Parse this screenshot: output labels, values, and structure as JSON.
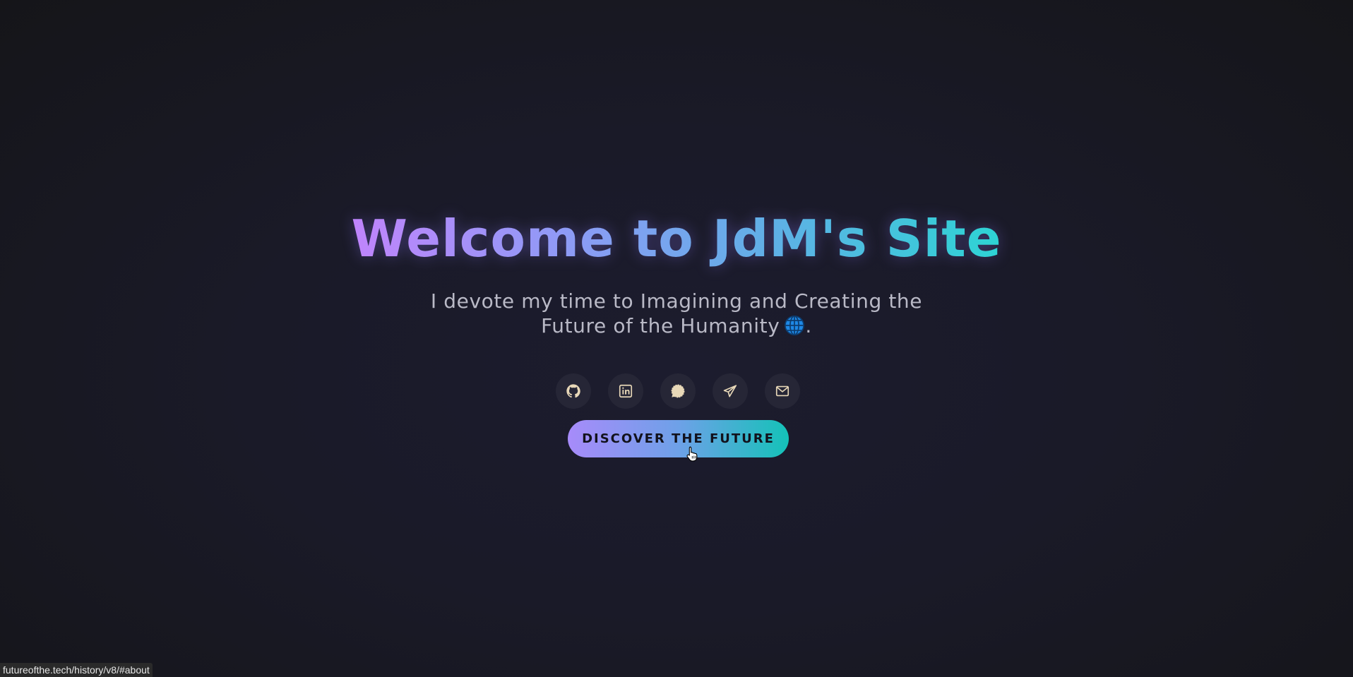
{
  "hero": {
    "title": "Welcome to JdM's Site",
    "subtitle_line1": "I devote my time to Imagining and Creating the",
    "subtitle_line2": "Future of the Humanity",
    "subtitle_end": ".",
    "cta_label": "DISCOVER THE FUTURE"
  },
  "socials": [
    {
      "icon": "github-icon"
    },
    {
      "icon": "linkedin-icon"
    },
    {
      "icon": "signal-icon"
    },
    {
      "icon": "telegram-icon"
    },
    {
      "icon": "mail-icon"
    }
  ],
  "status_bar": {
    "url": "futureofthe.tech/history/v8/#about"
  },
  "colors": {
    "gradient_start": "#c084fc",
    "gradient_end": "#2dd4d4",
    "icon_color": "#e8d8b8"
  }
}
